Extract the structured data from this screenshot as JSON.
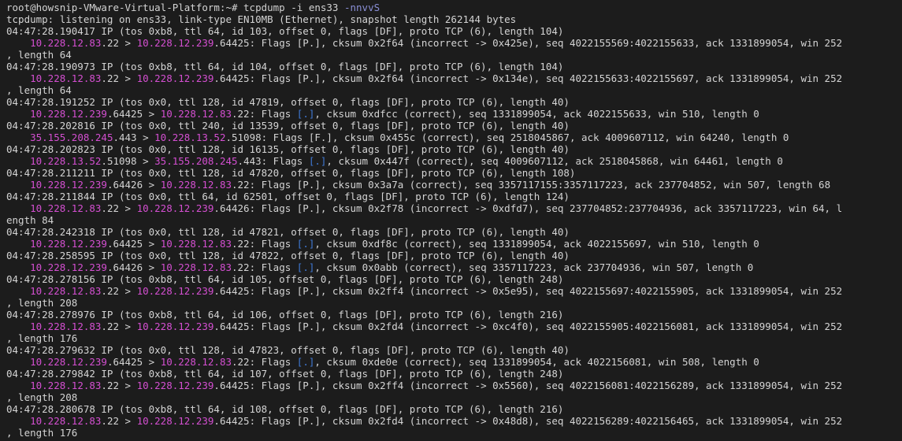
{
  "theme": {
    "background": "#1c1c1c",
    "text": "#d4d4d4",
    "ip_highlight": "#d44fd1",
    "flag_highlight": "#3f79d6",
    "option_highlight": "#8a8fd6"
  },
  "lines": [
    [
      [
        "root@howsnip-VMware-Virtual-Platform:~# ",
        "t"
      ],
      [
        "tcpdump ",
        "cmd"
      ],
      [
        "-i ens33 ",
        "t"
      ],
      [
        "-nnvvS",
        "opt"
      ]
    ],
    [
      [
        "tcpdump: listening on ens33, link-type EN10MB (Ethernet), snapshot length 262144 bytes",
        "t"
      ]
    ],
    [
      [
        "04:47:28.190417 IP (tos 0xb8, ttl 64, id 103, offset 0, flags [DF], proto TCP (6), length 104)",
        "t"
      ]
    ],
    [
      [
        "    ",
        "t"
      ],
      [
        "10.228.12.83",
        "ip"
      ],
      [
        ".22 > ",
        "t"
      ],
      [
        "10.228.12.239",
        "ip"
      ],
      [
        ".64425: Flags [P.], cksum 0x2f64 (incorrect -> 0x425e), seq 4022155569:4022155633, ack 1331899054, win 252",
        "t"
      ]
    ],
    [
      [
        ", length 64",
        "t"
      ]
    ],
    [
      [
        "04:47:28.190973 IP (tos 0xb8, ttl 64, id 104, offset 0, flags [DF], proto TCP (6), length 104)",
        "t"
      ]
    ],
    [
      [
        "    ",
        "t"
      ],
      [
        "10.228.12.83",
        "ip"
      ],
      [
        ".22 > ",
        "t"
      ],
      [
        "10.228.12.239",
        "ip"
      ],
      [
        ".64425: Flags [P.], cksum 0x2f64 (incorrect -> 0x134e), seq 4022155633:4022155697, ack 1331899054, win 252",
        "t"
      ]
    ],
    [
      [
        ", length 64",
        "t"
      ]
    ],
    [
      [
        "04:47:28.191252 IP (tos 0x0, ttl 128, id 47819, offset 0, flags [DF], proto TCP (6), length 40)",
        "t"
      ]
    ],
    [
      [
        "    ",
        "t"
      ],
      [
        "10.228.12.239",
        "ip"
      ],
      [
        ".64425 > ",
        "t"
      ],
      [
        "10.228.12.83",
        "ip"
      ],
      [
        ".22: Flags ",
        "t"
      ],
      [
        "[.]",
        "flag"
      ],
      [
        ", cksum 0xdfcc (correct), seq 1331899054, ack 4022155633, win 510, length 0",
        "t"
      ]
    ],
    [
      [
        "04:47:28.202816 IP (tos 0x0, ttl 240, id 13539, offset 0, flags [DF], proto TCP (6), length 40)",
        "t"
      ]
    ],
    [
      [
        "    ",
        "t"
      ],
      [
        "35.155.208.245",
        "ip"
      ],
      [
        ".443 > ",
        "t"
      ],
      [
        "10.228.13.52",
        "ip"
      ],
      [
        ".51098: Flags [F.], cksum 0x455c (correct), seq 2518045867, ack 4009607112, win 64240, length 0",
        "t"
      ]
    ],
    [
      [
        "04:47:28.202823 IP (tos 0x0, ttl 128, id 16135, offset 0, flags [DF], proto TCP (6), length 40)",
        "t"
      ]
    ],
    [
      [
        "    ",
        "t"
      ],
      [
        "10.228.13.52",
        "ip"
      ],
      [
        ".51098 > ",
        "t"
      ],
      [
        "35.155.208.245",
        "ip"
      ],
      [
        ".443: Flags ",
        "t"
      ],
      [
        "[.]",
        "flag"
      ],
      [
        ", cksum 0x447f (correct), seq 4009607112, ack 2518045868, win 64461, length 0",
        "t"
      ]
    ],
    [
      [
        "04:47:28.211211 IP (tos 0x0, ttl 128, id 47820, offset 0, flags [DF], proto TCP (6), length 108)",
        "t"
      ]
    ],
    [
      [
        "    ",
        "t"
      ],
      [
        "10.228.12.239",
        "ip"
      ],
      [
        ".64426 > ",
        "t"
      ],
      [
        "10.228.12.83",
        "ip"
      ],
      [
        ".22: Flags [P.], cksum 0x3a7a (correct), seq 3357117155:3357117223, ack 237704852, win 507, length 68",
        "t"
      ]
    ],
    [
      [
        "04:47:28.211844 IP (tos 0x0, ttl 64, id 62501, offset 0, flags [DF], proto TCP (6), length 124)",
        "t"
      ]
    ],
    [
      [
        "    ",
        "t"
      ],
      [
        "10.228.12.83",
        "ip"
      ],
      [
        ".22 > ",
        "t"
      ],
      [
        "10.228.12.239",
        "ip"
      ],
      [
        ".64426: Flags [P.], cksum 0x2f78 (incorrect -> 0xdfd7), seq 237704852:237704936, ack 3357117223, win 64, l",
        "t"
      ]
    ],
    [
      [
        "ength 84",
        "t"
      ]
    ],
    [
      [
        "04:47:28.242318 IP (tos 0x0, ttl 128, id 47821, offset 0, flags [DF], proto TCP (6), length 40)",
        "t"
      ]
    ],
    [
      [
        "    ",
        "t"
      ],
      [
        "10.228.12.239",
        "ip"
      ],
      [
        ".64425 > ",
        "t"
      ],
      [
        "10.228.12.83",
        "ip"
      ],
      [
        ".22: Flags ",
        "t"
      ],
      [
        "[.]",
        "flag"
      ],
      [
        ", cksum 0xdf8c (correct), seq 1331899054, ack 4022155697, win 510, length 0",
        "t"
      ]
    ],
    [
      [
        "04:47:28.258595 IP (tos 0x0, ttl 128, id 47822, offset 0, flags [DF], proto TCP (6), length 40)",
        "t"
      ]
    ],
    [
      [
        "    ",
        "t"
      ],
      [
        "10.228.12.239",
        "ip"
      ],
      [
        ".64426 > ",
        "t"
      ],
      [
        "10.228.12.83",
        "ip"
      ],
      [
        ".22: Flags ",
        "t"
      ],
      [
        "[.]",
        "flag"
      ],
      [
        ", cksum 0x0abb (correct), seq 3357117223, ack 237704936, win 507, length 0",
        "t"
      ]
    ],
    [
      [
        "04:47:28.278156 IP (tos 0xb8, ttl 64, id 105, offset 0, flags [DF], proto TCP (6), length 248)",
        "t"
      ]
    ],
    [
      [
        "    ",
        "t"
      ],
      [
        "10.228.12.83",
        "ip"
      ],
      [
        ".22 > ",
        "t"
      ],
      [
        "10.228.12.239",
        "ip"
      ],
      [
        ".64425: Flags [P.], cksum 0x2ff4 (incorrect -> 0x5e95), seq 4022155697:4022155905, ack 1331899054, win 252",
        "t"
      ]
    ],
    [
      [
        ", length 208",
        "t"
      ]
    ],
    [
      [
        "04:47:28.278976 IP (tos 0xb8, ttl 64, id 106, offset 0, flags [DF], proto TCP (6), length 216)",
        "t"
      ]
    ],
    [
      [
        "    ",
        "t"
      ],
      [
        "10.228.12.83",
        "ip"
      ],
      [
        ".22 > ",
        "t"
      ],
      [
        "10.228.12.239",
        "ip"
      ],
      [
        ".64425: Flags [P.], cksum 0x2fd4 (incorrect -> 0xc4f0), seq 4022155905:4022156081, ack 1331899054, win 252",
        "t"
      ]
    ],
    [
      [
        ", length 176",
        "t"
      ]
    ],
    [
      [
        "04:47:28.279632 IP (tos 0x0, ttl 128, id 47823, offset 0, flags [DF], proto TCP (6), length 40)",
        "t"
      ]
    ],
    [
      [
        "    ",
        "t"
      ],
      [
        "10.228.12.239",
        "ip"
      ],
      [
        ".64425 > ",
        "t"
      ],
      [
        "10.228.12.83",
        "ip"
      ],
      [
        ".22: Flags ",
        "t"
      ],
      [
        "[.]",
        "flag"
      ],
      [
        ", cksum 0xde0e (correct), seq 1331899054, ack 4022156081, win 508, length 0",
        "t"
      ]
    ],
    [
      [
        "04:47:28.279842 IP (tos 0xb8, ttl 64, id 107, offset 0, flags [DF], proto TCP (6), length 248)",
        "t"
      ]
    ],
    [
      [
        "    ",
        "t"
      ],
      [
        "10.228.12.83",
        "ip"
      ],
      [
        ".22 > ",
        "t"
      ],
      [
        "10.228.12.239",
        "ip"
      ],
      [
        ".64425: Flags [P.], cksum 0x2ff4 (incorrect -> 0x5560), seq 4022156081:4022156289, ack 1331899054, win 252",
        "t"
      ]
    ],
    [
      [
        ", length 208",
        "t"
      ]
    ],
    [
      [
        "04:47:28.280678 IP (tos 0xb8, ttl 64, id 108, offset 0, flags [DF], proto TCP (6), length 216)",
        "t"
      ]
    ],
    [
      [
        "    ",
        "t"
      ],
      [
        "10.228.12.83",
        "ip"
      ],
      [
        ".22 > ",
        "t"
      ],
      [
        "10.228.12.239",
        "ip"
      ],
      [
        ".64425: Flags [P.], cksum 0x2fd4 (incorrect -> 0x48d8), seq 4022156289:4022156465, ack 1331899054, win 252",
        "t"
      ]
    ],
    [
      [
        ", length 176",
        "t"
      ]
    ]
  ]
}
